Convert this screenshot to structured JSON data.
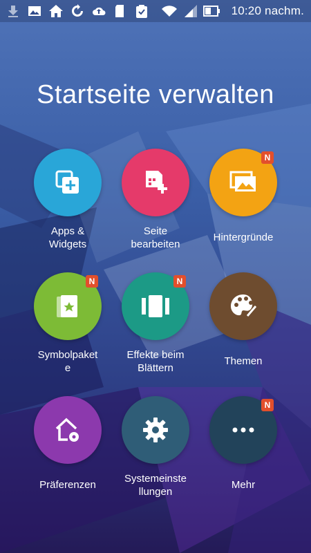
{
  "statusbar": {
    "time": "10:20 nachm.",
    "icons": [
      "download-icon",
      "image-icon",
      "home-icon",
      "sync-icon",
      "cloud-upload-icon",
      "sd-card-icon",
      "clipboard-check-icon",
      "wifi-icon",
      "signal-icon",
      "battery-icon"
    ]
  },
  "page": {
    "title": "Startseite verwalten"
  },
  "badge_text": "N",
  "colors": {
    "apps": "#29a6d8",
    "seite": "#e53a6a",
    "hintergruende": "#f3a313",
    "symbolpakete": "#7dbb36",
    "effekte": "#1c9a86",
    "themen": "#6e4c2f",
    "praeferenzen": "#8c39ad",
    "systemeinstellungen": "#2f5d77",
    "mehr": "#22435a",
    "badge": "#e24f2c"
  },
  "tiles": {
    "apps": "Apps &\nWidgets",
    "seite": "Seite\nbearbeiten",
    "hintergruende": "Hintergründe",
    "symbolpakete": "Symbolpaket\ne",
    "effekte": "Effekte beim\nBlättern",
    "themen": "Themen",
    "praeferenzen": "Präferenzen",
    "systemeinstellungen": "Systemeinste\nllungen",
    "mehr": "Mehr"
  }
}
